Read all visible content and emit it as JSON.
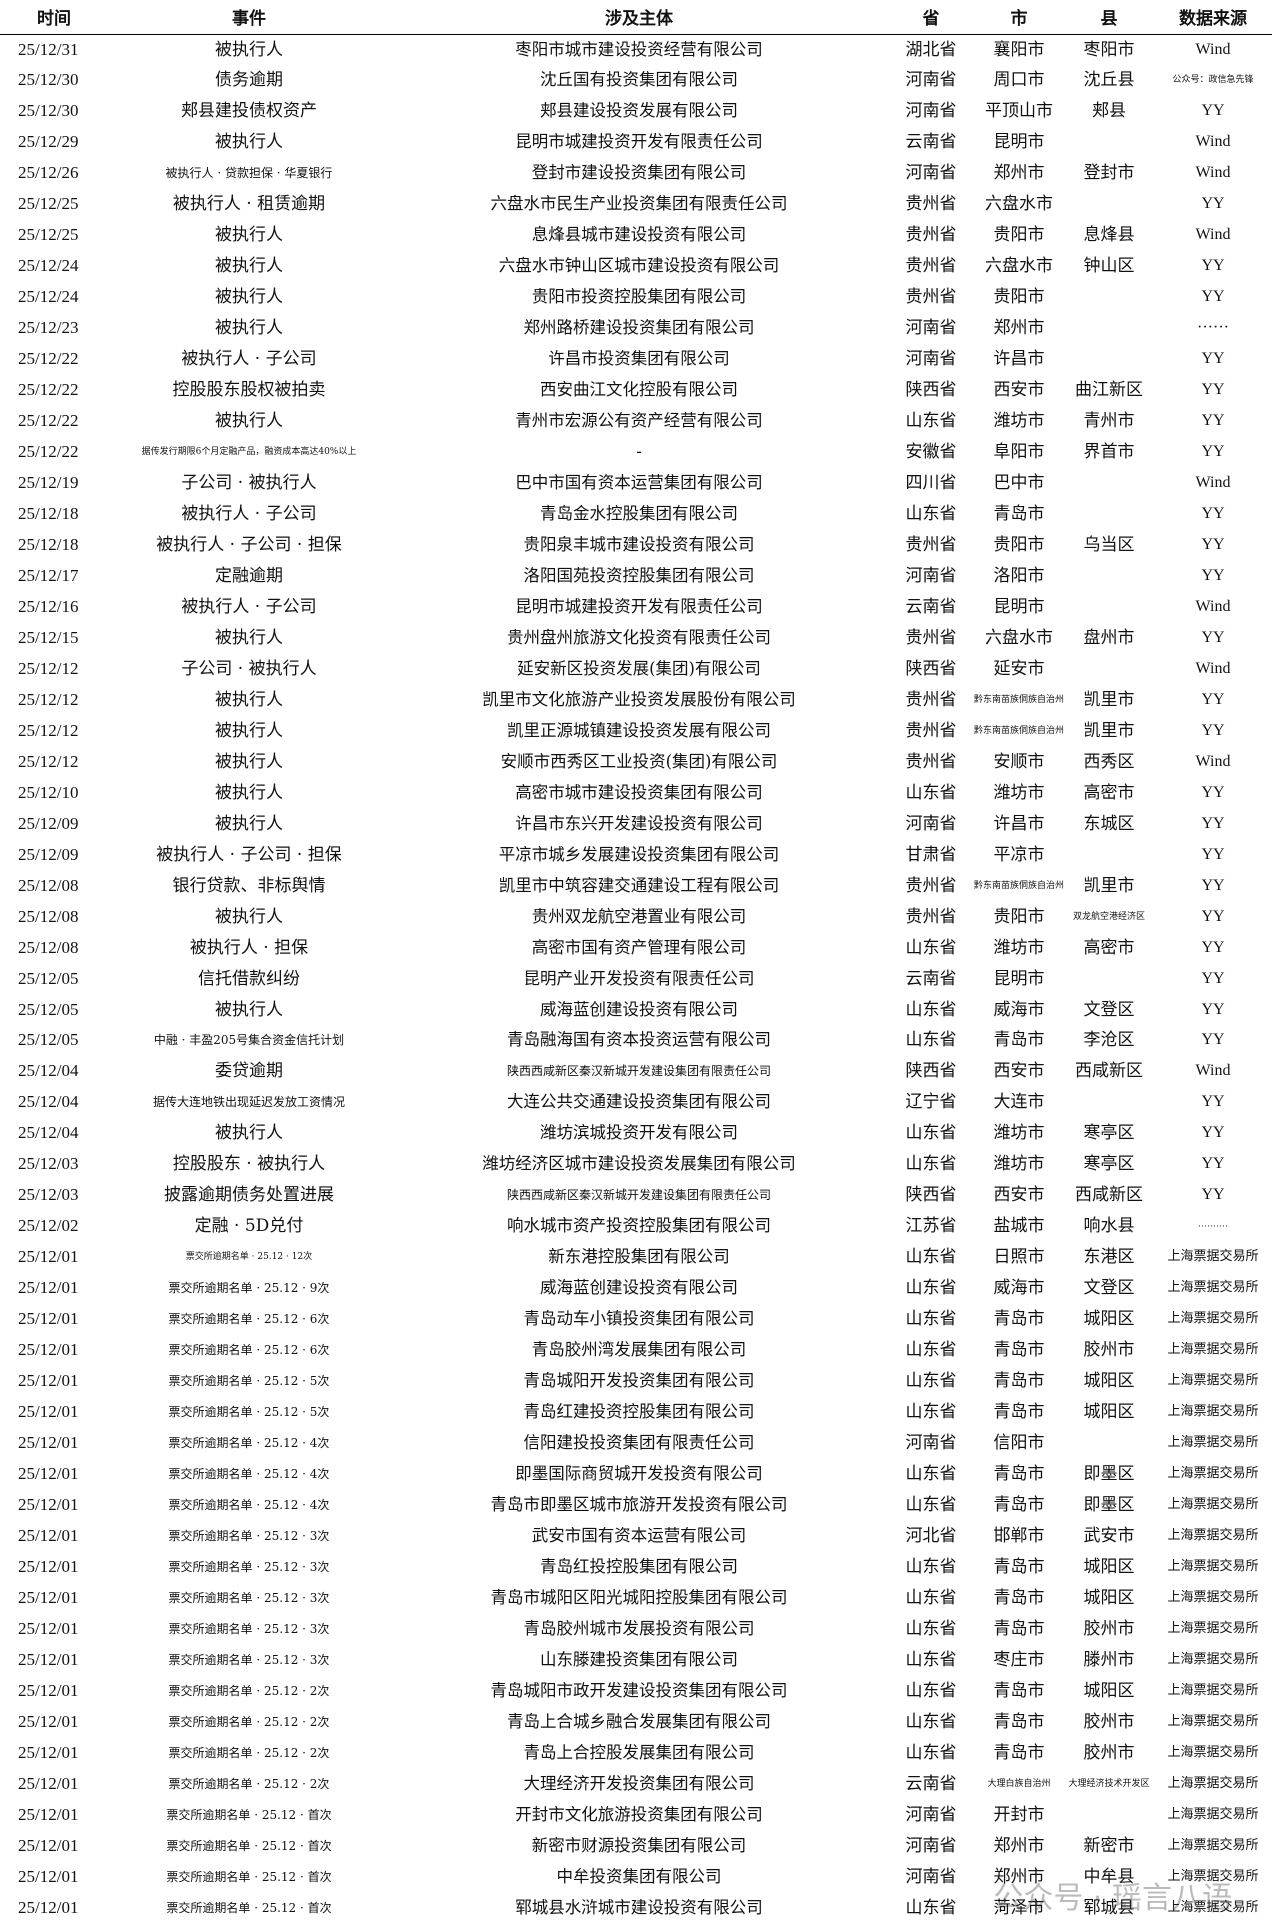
{
  "headers": [
    "时间",
    "事件",
    "涉及主体",
    "省",
    "市",
    "县",
    "数据来源"
  ],
  "watermark": "公众号 · 瑶言八语",
  "rows": [
    [
      "25/12/31",
      "被执行人",
      "枣阳市城市建设投资经营有限公司",
      "湖北省",
      "襄阳市",
      "枣阳市",
      "Wind"
    ],
    [
      "25/12/30",
      "债务逾期",
      "沈丘国有投资集团有限公司",
      "河南省",
      "周口市",
      "沈丘县",
      "公众号：政信急先锋"
    ],
    [
      "25/12/30",
      "郏县建投债权资产",
      "郏县建设投资发展有限公司",
      "河南省",
      "平顶山市",
      "郏县",
      "YY"
    ],
    [
      "25/12/29",
      "被执行人",
      "昆明市城建投资开发有限责任公司",
      "云南省",
      "昆明市",
      "",
      "Wind"
    ],
    [
      "25/12/26",
      "被执行人 · 贷款担保 · 华夏银行",
      "登封市建设投资集团有限公司",
      "河南省",
      "郑州市",
      "登封市",
      "Wind"
    ],
    [
      "25/12/25",
      "被执行人 · 租赁逾期",
      "六盘水市民生产业投资集团有限责任公司",
      "贵州省",
      "六盘水市",
      "",
      "YY"
    ],
    [
      "25/12/25",
      "被执行人",
      "息烽县城市建设投资有限公司",
      "贵州省",
      "贵阳市",
      "息烽县",
      "Wind"
    ],
    [
      "25/12/24",
      "被执行人",
      "六盘水市钟山区城市建设投资有限公司",
      "贵州省",
      "六盘水市",
      "钟山区",
      "YY"
    ],
    [
      "25/12/24",
      "被执行人",
      "贵阳市投资控股集团有限公司",
      "贵州省",
      "贵阳市",
      "",
      "YY"
    ],
    [
      "25/12/23",
      "被执行人",
      "郑州路桥建设投资集团有限公司",
      "河南省",
      "郑州市",
      "",
      "······"
    ],
    [
      "25/12/22",
      "被执行人 · 子公司",
      "许昌市投资集团有限公司",
      "河南省",
      "许昌市",
      "",
      "YY"
    ],
    [
      "25/12/22",
      "控股股东股权被拍卖",
      "西安曲江文化控股有限公司",
      "陕西省",
      "西安市",
      "曲江新区",
      "YY"
    ],
    [
      "25/12/22",
      "被执行人",
      "青州市宏源公有资产经营有限公司",
      "山东省",
      "潍坊市",
      "青州市",
      "YY"
    ],
    [
      "25/12/22",
      "据传发行期限6个月定融产品，融资成本高达40%以上",
      "-",
      "安徽省",
      "阜阳市",
      "界首市",
      "YY"
    ],
    [
      "25/12/19",
      "子公司 · 被执行人",
      "巴中市国有资本运营集团有限公司",
      "四川省",
      "巴中市",
      "",
      "Wind"
    ],
    [
      "25/12/18",
      "被执行人 · 子公司",
      "青岛金水控股集团有限公司",
      "山东省",
      "青岛市",
      "",
      "YY"
    ],
    [
      "25/12/18",
      "被执行人 · 子公司 · 担保",
      "贵阳泉丰城市建设投资有限公司",
      "贵州省",
      "贵阳市",
      "乌当区",
      "YY"
    ],
    [
      "25/12/17",
      "定融逾期",
      "洛阳国苑投资控股集团有限公司",
      "河南省",
      "洛阳市",
      "",
      "YY"
    ],
    [
      "25/12/16",
      "被执行人 · 子公司",
      "昆明市城建投资开发有限责任公司",
      "云南省",
      "昆明市",
      "",
      "Wind"
    ],
    [
      "25/12/15",
      "被执行人",
      "贵州盘州旅游文化投资有限责任公司",
      "贵州省",
      "六盘水市",
      "盘州市",
      "YY"
    ],
    [
      "25/12/12",
      "子公司 · 被执行人",
      "延安新区投资发展(集团)有限公司",
      "陕西省",
      "延安市",
      "",
      "Wind"
    ],
    [
      "25/12/12",
      "被执行人",
      "凯里市文化旅游产业投资发展股份有限公司",
      "贵州省",
      "黔东南苗族侗族自治州",
      "凯里市",
      "YY"
    ],
    [
      "25/12/12",
      "被执行人",
      "凯里正源城镇建设投资发展有限公司",
      "贵州省",
      "黔东南苗族侗族自治州",
      "凯里市",
      "YY"
    ],
    [
      "25/12/12",
      "被执行人",
      "安顺市西秀区工业投资(集团)有限公司",
      "贵州省",
      "安顺市",
      "西秀区",
      "Wind"
    ],
    [
      "25/12/10",
      "被执行人",
      "高密市城市建设投资集团有限公司",
      "山东省",
      "潍坊市",
      "高密市",
      "YY"
    ],
    [
      "25/12/09",
      "被执行人",
      "许昌市东兴开发建设投资有限公司",
      "河南省",
      "许昌市",
      "东城区",
      "YY"
    ],
    [
      "25/12/09",
      "被执行人 · 子公司 · 担保",
      "平凉市城乡发展建设投资集团有限公司",
      "甘肃省",
      "平凉市",
      "",
      "YY"
    ],
    [
      "25/12/08",
      "银行贷款、非标舆情",
      "凯里市中筑容建交通建设工程有限公司",
      "贵州省",
      "黔东南苗族侗族自治州",
      "凯里市",
      "YY"
    ],
    [
      "25/12/08",
      "被执行人",
      "贵州双龙航空港置业有限公司",
      "贵州省",
      "贵阳市",
      "双龙航空港经济区",
      "YY"
    ],
    [
      "25/12/08",
      "被执行人 · 担保",
      "高密市国有资产管理有限公司",
      "山东省",
      "潍坊市",
      "高密市",
      "YY"
    ],
    [
      "25/12/05",
      "信托借款纠纷",
      "昆明产业开发投资有限责任公司",
      "云南省",
      "昆明市",
      "",
      "YY"
    ],
    [
      "25/12/05",
      "被执行人",
      "威海蓝创建设投资有限公司",
      "山东省",
      "威海市",
      "文登区",
      "YY"
    ],
    [
      "25/12/05",
      "中融 · 丰盈205号集合资金信托计划",
      "青岛融海国有资本投资运营有限公司",
      "山东省",
      "青岛市",
      "李沧区",
      "YY"
    ],
    [
      "25/12/04",
      "委贷逾期",
      "陕西西咸新区秦汉新城开发建设集团有限责任公司",
      "陕西省",
      "西安市",
      "西咸新区",
      "Wind"
    ],
    [
      "25/12/04",
      "据传大连地铁出现延迟发放工资情况",
      "大连公共交通建设投资集团有限公司",
      "辽宁省",
      "大连市",
      "",
      "YY"
    ],
    [
      "25/12/04",
      "被执行人",
      "潍坊滨城投资开发有限公司",
      "山东省",
      "潍坊市",
      "寒亭区",
      "YY"
    ],
    [
      "25/12/03",
      "控股股东 · 被执行人",
      "潍坊经济区城市建设投资发展集团有限公司",
      "山东省",
      "潍坊市",
      "寒亭区",
      "YY"
    ],
    [
      "25/12/03",
      "披露逾期债务处置进展",
      "陕西西咸新区秦汉新城开发建设集团有限责任公司",
      "陕西省",
      "西安市",
      "西咸新区",
      "YY"
    ],
    [
      "25/12/02",
      "定融 · 5D兑付",
      "响水城市资产投资控股集团有限公司",
      "江苏省",
      "盐城市",
      "响水县",
      "··········"
    ],
    [
      "25/12/01",
      "票交所逾期名单 · 25.12 · 12次",
      "新东港控股集团有限公司",
      "山东省",
      "日照市",
      "东港区",
      "上海票据交易所"
    ],
    [
      "25/12/01",
      "票交所逾期名单 · 25.12 · 9次",
      "威海蓝创建设投资有限公司",
      "山东省",
      "威海市",
      "文登区",
      "上海票据交易所"
    ],
    [
      "25/12/01",
      "票交所逾期名单 · 25.12 · 6次",
      "青岛动车小镇投资集团有限公司",
      "山东省",
      "青岛市",
      "城阳区",
      "上海票据交易所"
    ],
    [
      "25/12/01",
      "票交所逾期名单 · 25.12 · 6次",
      "青岛胶州湾发展集团有限公司",
      "山东省",
      "青岛市",
      "胶州市",
      "上海票据交易所"
    ],
    [
      "25/12/01",
      "票交所逾期名单 · 25.12 · 5次",
      "青岛城阳开发投资集团有限公司",
      "山东省",
      "青岛市",
      "城阳区",
      "上海票据交易所"
    ],
    [
      "25/12/01",
      "票交所逾期名单 · 25.12 · 5次",
      "青岛红建投资控股集团有限公司",
      "山东省",
      "青岛市",
      "城阳区",
      "上海票据交易所"
    ],
    [
      "25/12/01",
      "票交所逾期名单 · 25.12 · 4次",
      "信阳建投投资集团有限责任公司",
      "河南省",
      "信阳市",
      "",
      "上海票据交易所"
    ],
    [
      "25/12/01",
      "票交所逾期名单 · 25.12 · 4次",
      "即墨国际商贸城开发投资有限公司",
      "山东省",
      "青岛市",
      "即墨区",
      "上海票据交易所"
    ],
    [
      "25/12/01",
      "票交所逾期名单 · 25.12 · 4次",
      "青岛市即墨区城市旅游开发投资有限公司",
      "山东省",
      "青岛市",
      "即墨区",
      "上海票据交易所"
    ],
    [
      "25/12/01",
      "票交所逾期名单 · 25.12 · 3次",
      "武安市国有资本运营有限公司",
      "河北省",
      "邯郸市",
      "武安市",
      "上海票据交易所"
    ],
    [
      "25/12/01",
      "票交所逾期名单 · 25.12 · 3次",
      "青岛红投控股集团有限公司",
      "山东省",
      "青岛市",
      "城阳区",
      "上海票据交易所"
    ],
    [
      "25/12/01",
      "票交所逾期名单 · 25.12 · 3次",
      "青岛市城阳区阳光城阳控股集团有限公司",
      "山东省",
      "青岛市",
      "城阳区",
      "上海票据交易所"
    ],
    [
      "25/12/01",
      "票交所逾期名单 · 25.12 · 3次",
      "青岛胶州城市发展投资有限公司",
      "山东省",
      "青岛市",
      "胶州市",
      "上海票据交易所"
    ],
    [
      "25/12/01",
      "票交所逾期名单 · 25.12 · 3次",
      "山东滕建投资集团有限公司",
      "山东省",
      "枣庄市",
      "滕州市",
      "上海票据交易所"
    ],
    [
      "25/12/01",
      "票交所逾期名单 · 25.12 · 2次",
      "青岛城阳市政开发建设投资集团有限公司",
      "山东省",
      "青岛市",
      "城阳区",
      "上海票据交易所"
    ],
    [
      "25/12/01",
      "票交所逾期名单 · 25.12 · 2次",
      "青岛上合城乡融合发展集团有限公司",
      "山东省",
      "青岛市",
      "胶州市",
      "上海票据交易所"
    ],
    [
      "25/12/01",
      "票交所逾期名单 · 25.12 · 2次",
      "青岛上合控股发展集团有限公司",
      "山东省",
      "青岛市",
      "胶州市",
      "上海票据交易所"
    ],
    [
      "25/12/01",
      "票交所逾期名单 · 25.12 · 2次",
      "大理经济开发投资集团有限公司",
      "云南省",
      "大理白族自治州",
      "大理经济技术开发区",
      "上海票据交易所"
    ],
    [
      "25/12/01",
      "票交所逾期名单 · 25.12 · 首次",
      "开封市文化旅游投资集团有限公司",
      "河南省",
      "开封市",
      "",
      "上海票据交易所"
    ],
    [
      "25/12/01",
      "票交所逾期名单 · 25.12 · 首次",
      "新密市财源投资集团有限公司",
      "河南省",
      "郑州市",
      "新密市",
      "上海票据交易所"
    ],
    [
      "25/12/01",
      "票交所逾期名单 · 25.12 · 首次",
      "中牟投资集团有限公司",
      "河南省",
      "郑州市",
      "中牟县",
      "上海票据交易所"
    ],
    [
      "25/12/01",
      "票交所逾期名单 · 25.12 · 首次",
      "郓城县水浒城市建设投资有限公司",
      "山东省",
      "菏泽市",
      "郓城县",
      "上海票据交易所"
    ]
  ]
}
